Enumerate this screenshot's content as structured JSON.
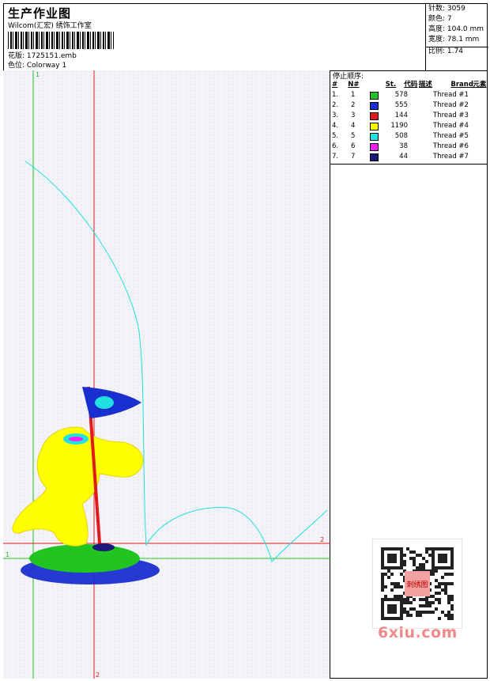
{
  "header": {
    "title": "生产作业图",
    "company": "Wilcom(汇宏) 绣饰工作室",
    "design_label": "花版: 1725151.emb",
    "colorway_label": "色位: Colorway 1"
  },
  "stats": {
    "stitches": "针数: 3059",
    "colors": "颜色: 7",
    "height": "高度: 104.0 mm",
    "width": "宽度: 78.1 mm",
    "scale": "比例: 1.74"
  },
  "panel": {
    "stop_sequence_label": "停止顺序:",
    "columns": [
      "#",
      "N#",
      "St.",
      "代码",
      "描述",
      "Brand",
      "元素"
    ],
    "threads": [
      {
        "num": "1.",
        "n": "1",
        "color": "#22c422",
        "st": "578",
        "desc": "Thread #1"
      },
      {
        "num": "2.",
        "n": "2",
        "color": "#1a2fd0",
        "st": "555",
        "desc": "Thread #2"
      },
      {
        "num": "3.",
        "n": "3",
        "color": "#e01a1a",
        "st": "144",
        "desc": "Thread #3"
      },
      {
        "num": "4.",
        "n": "4",
        "color": "#ffff00",
        "st": "1190",
        "desc": "Thread #4"
      },
      {
        "num": "5.",
        "n": "5",
        "color": "#20e0e0",
        "st": "508",
        "desc": "Thread #5"
      },
      {
        "num": "6.",
        "n": "6",
        "color": "#f020f0",
        "st": "38",
        "desc": "Thread #6"
      },
      {
        "num": "7.",
        "n": "7",
        "color": "#1a1a7a",
        "st": "44",
        "desc": "Thread #7"
      }
    ]
  },
  "canvas": {
    "axis_label_1_top": "1",
    "axis_label_1_left": "1",
    "axis_label_2_right": "2",
    "axis_label_2_bottom": "2"
  },
  "watermark": "6xiu.com",
  "qr_center_text": "刺绣图"
}
